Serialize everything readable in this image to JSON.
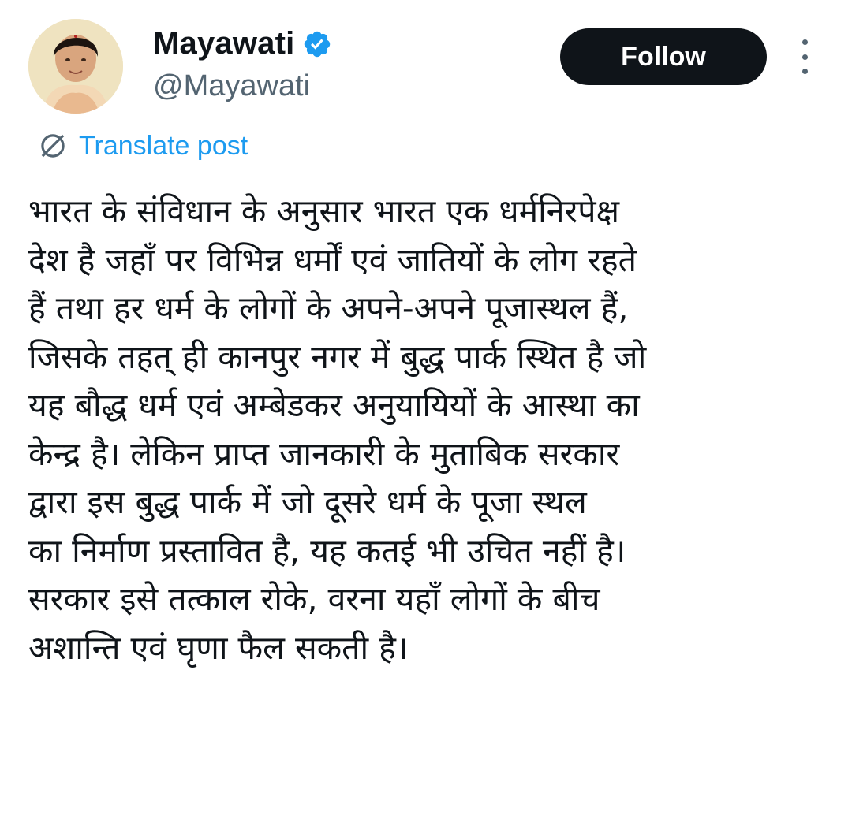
{
  "author": {
    "display_name": "Mayawati",
    "handle": "@Mayawati",
    "verified": true,
    "verified_icon": "verified-badge-icon",
    "avatar_icon": "profile-photo"
  },
  "actions": {
    "follow_label": "Follow",
    "more_icon": "more-vertical-icon"
  },
  "translate": {
    "label": "Translate post",
    "icon": "globe-icon"
  },
  "tweet": {
    "lines": [
      "भारत के संविधान के अनुसार भारत एक धर्मनिरपेक्ष",
      "देश है जहाँ पर विभिन्न धर्मों एवं जातियों के लोग रहते",
      "हैं तथा हर धर्म के लोगों के अपने-अपने पूजास्थल हैं,",
      "जिसके तहत् ही कानपुर नगर में बुद्ध पार्क स्थित है जो",
      "यह बौद्ध धर्म एवं अम्बेडकर अनुयायियों के आस्था का",
      "केन्द्र है। लेकिन प्राप्त जानकारी के मुताबिक सरकार",
      "द्वारा इस बुद्ध पार्क में जो दूसरे धर्म के पूजा स्थल",
      "का निर्माण प्रस्तावित है, यह कतई भी उचित नहीं है।",
      "सरकार इसे तत्काल रोके, वरना यहाँ लोगों के बीच",
      "अशान्ति एवं घृणा फैल सकती है।"
    ]
  },
  "colors": {
    "text_primary": "#0f1419",
    "text_secondary": "#536471",
    "link_blue": "#1d9bf0",
    "follow_bg": "#0f1419",
    "follow_text": "#ffffff",
    "verified_blue": "#1d9bf0"
  }
}
